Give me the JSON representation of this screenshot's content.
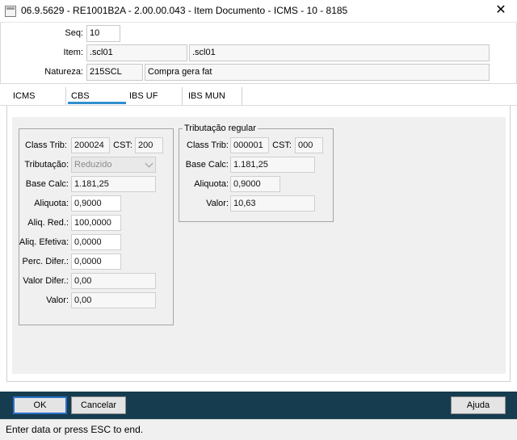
{
  "window": {
    "title": "06.9.5629 - RE1001B2A - 2.00.00.043 - Item Documento - ICMS - 10 - 8185",
    "close_glyph": "✕"
  },
  "header_fields": {
    "seq_label": "Seq:",
    "seq_value": "10",
    "item_label": "Item:",
    "item_code": ".scl01",
    "item_desc": ".scl01",
    "natureza_label": "Natureza:",
    "natureza_code": "215SCL",
    "natureza_desc": "Compra gera fat"
  },
  "tabs": [
    {
      "label": "ICMS",
      "active": false
    },
    {
      "label": "CBS",
      "active": true
    },
    {
      "label": "IBS UF",
      "active": false
    },
    {
      "label": "IBS MUN",
      "active": false
    }
  ],
  "cbs_group": {
    "class_trib_label": "Class Trib:",
    "class_trib_value": "200024",
    "cst_label": "CST:",
    "cst_value": "200",
    "tributacao_label": "Tributação:",
    "tributacao_value": "Reduzido",
    "base_calc_label": "Base Calc:",
    "base_calc_value": "1.181,25",
    "aliquota_label": "Aliquota:",
    "aliquota_value": "0,9000",
    "aliq_red_label": "Aliq. Red.:",
    "aliq_red_value": "100,0000",
    "aliq_efetiva_label": "Aliq. Efetiva:",
    "aliq_efetiva_value": "0,0000",
    "perc_difer_label": "Perc. Difer.:",
    "perc_difer_value": "0,0000",
    "valor_difer_label": "Valor Difer.:",
    "valor_difer_value": "0,00",
    "valor_label": "Valor:",
    "valor_value": "0,00"
  },
  "regular_group": {
    "title": "Tributação regular",
    "class_trib_label": "Class Trib:",
    "class_trib_value": "000001",
    "cst_label": "CST:",
    "cst_value": "000",
    "base_calc_label": "Base Calc:",
    "base_calc_value": "1.181,25",
    "aliquota_label": "Aliquota:",
    "aliquota_value": "0,9000",
    "valor_label": "Valor:",
    "valor_value": "10,63"
  },
  "buttons": {
    "ok": "OK",
    "cancel": "Cancelar",
    "help": "Ajuda"
  },
  "status": {
    "text": "Enter data or press ESC to end."
  },
  "colors": {
    "bottom_bar": "#163c4f",
    "active_tab_underline": "#2f8fd0"
  }
}
